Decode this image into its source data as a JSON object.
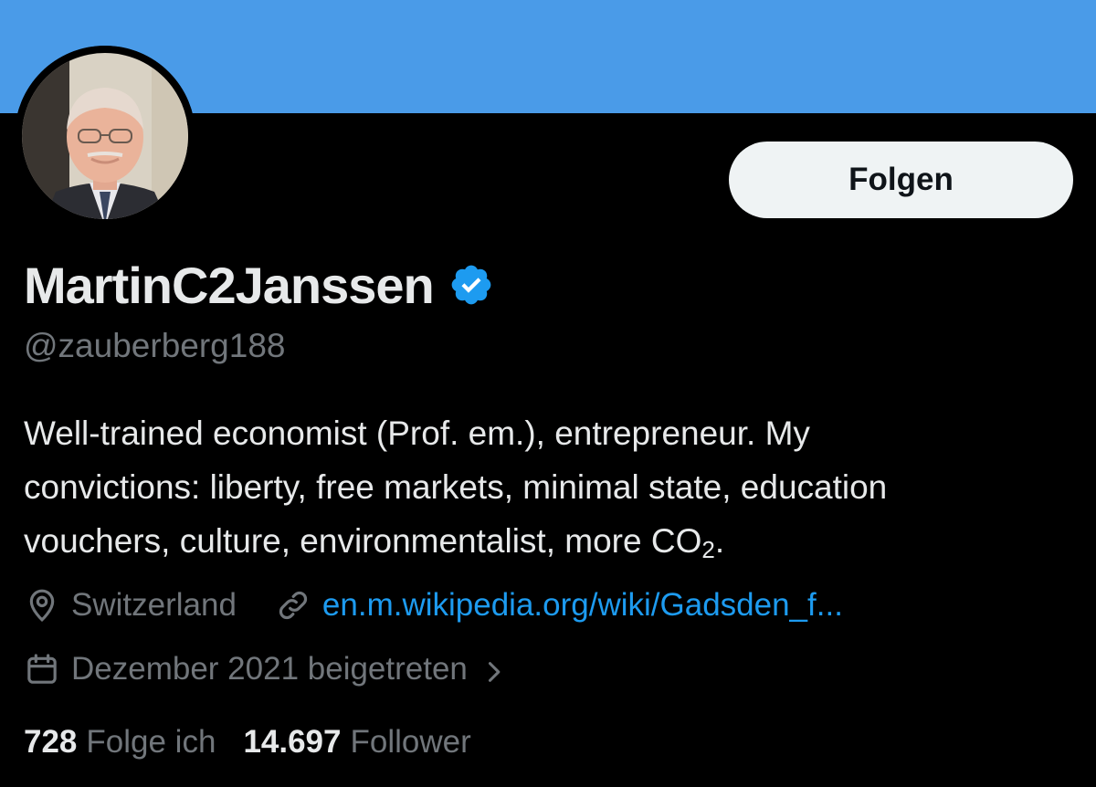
{
  "profile": {
    "display_name": "MartinC2Janssen",
    "handle": "@zauberberg188",
    "verified": true,
    "bio_lines": [
      "Well-trained economist (Prof. em.), entrepreneur. My",
      "convictions: liberty, free markets, minimal state, education"
    ],
    "bio_last_line_prefix": "vouchers, culture, environmentalist, more CO",
    "bio_subscript": "2",
    "bio_suffix": ".",
    "location": "Switzerland",
    "website": "en.m.wikipedia.org/wiki/Gadsden_f...",
    "joined": "Dezember 2021 beigetreten",
    "following_count": "728",
    "following_label": "Folge ich",
    "followers_count": "14.697",
    "followers_label": "Follower"
  },
  "actions": {
    "follow_label": "Folgen"
  },
  "icons": {
    "verified": "verified-badge-icon",
    "location": "location-pin-icon",
    "link": "link-icon",
    "calendar": "calendar-icon",
    "chevron": "chevron-right-icon"
  },
  "colors": {
    "banner": "#4a9be8",
    "background": "#000000",
    "primary_text": "#e7e9ea",
    "secondary_text": "#71767b",
    "link": "#1d9bf0",
    "verified": "#1d9bf0",
    "follow_button_bg": "#eff3f4"
  }
}
